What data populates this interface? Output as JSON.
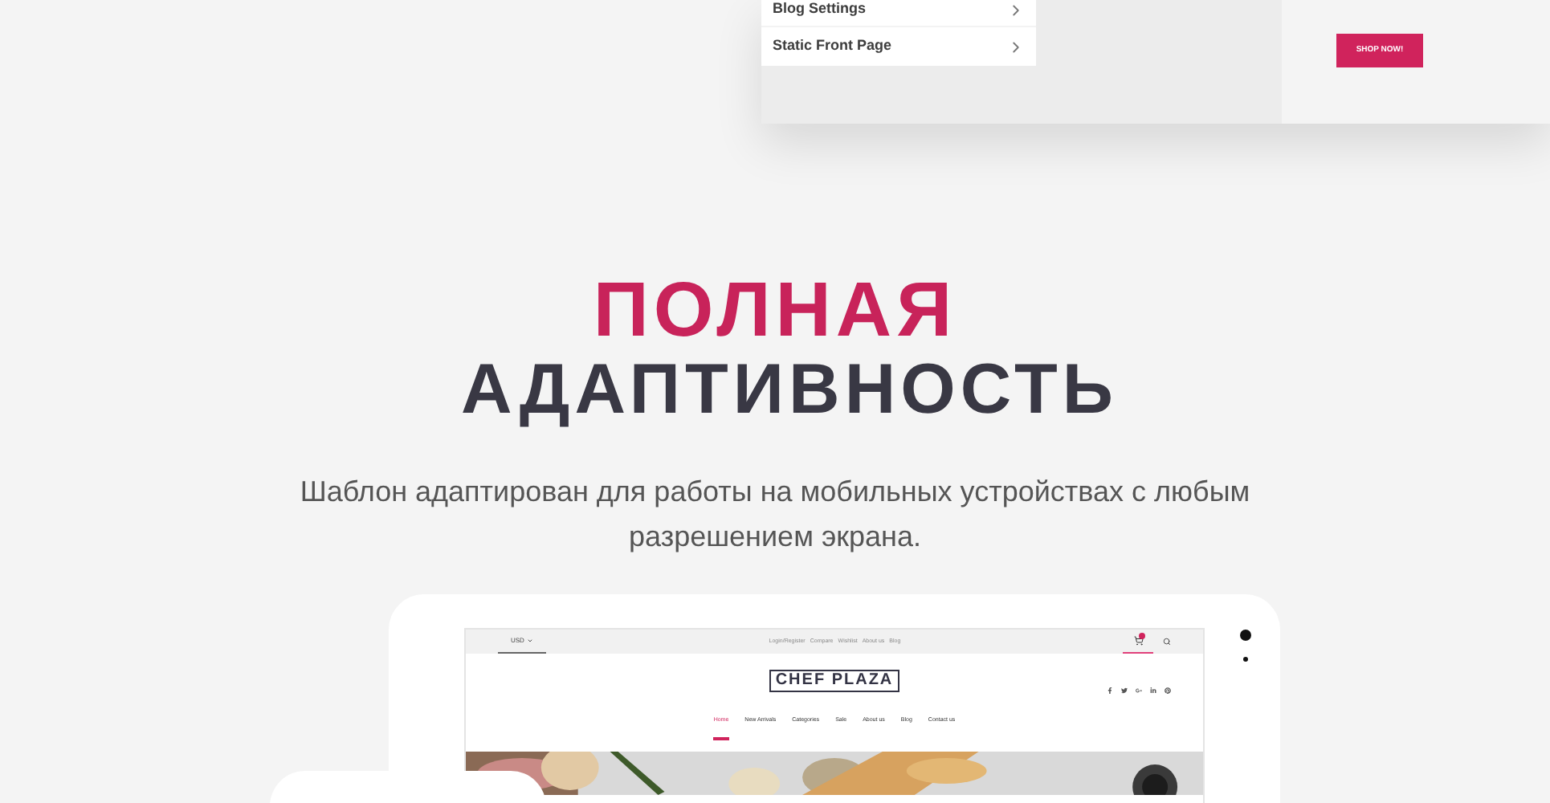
{
  "customizer_preview": {
    "menu_items": [
      {
        "label": "Blog Settings"
      },
      {
        "label": "Static Front Page"
      }
    ],
    "shop_button": "SHOP NOW!"
  },
  "heading": {
    "accent": "ПОЛНАЯ",
    "main": "АДАПТИВНОСТЬ"
  },
  "description": "Шаблон адаптирован для работы на мобильных устройствах с любым разрешением экрана.",
  "tablet": {
    "currency": "USD",
    "top_links": [
      "Login/Register",
      "Compare",
      "Wishlist",
      "About us",
      "Blog"
    ],
    "logo": "CHEF PLAZA",
    "nav": [
      {
        "label": "Home",
        "selected": true
      },
      {
        "label": "New Arrivals",
        "selected": false
      },
      {
        "label": "Categories",
        "selected": false
      },
      {
        "label": "Sale",
        "selected": false
      },
      {
        "label": "About us",
        "selected": false
      },
      {
        "label": "Blog",
        "selected": false
      },
      {
        "label": "Contact us",
        "selected": false
      }
    ]
  }
}
